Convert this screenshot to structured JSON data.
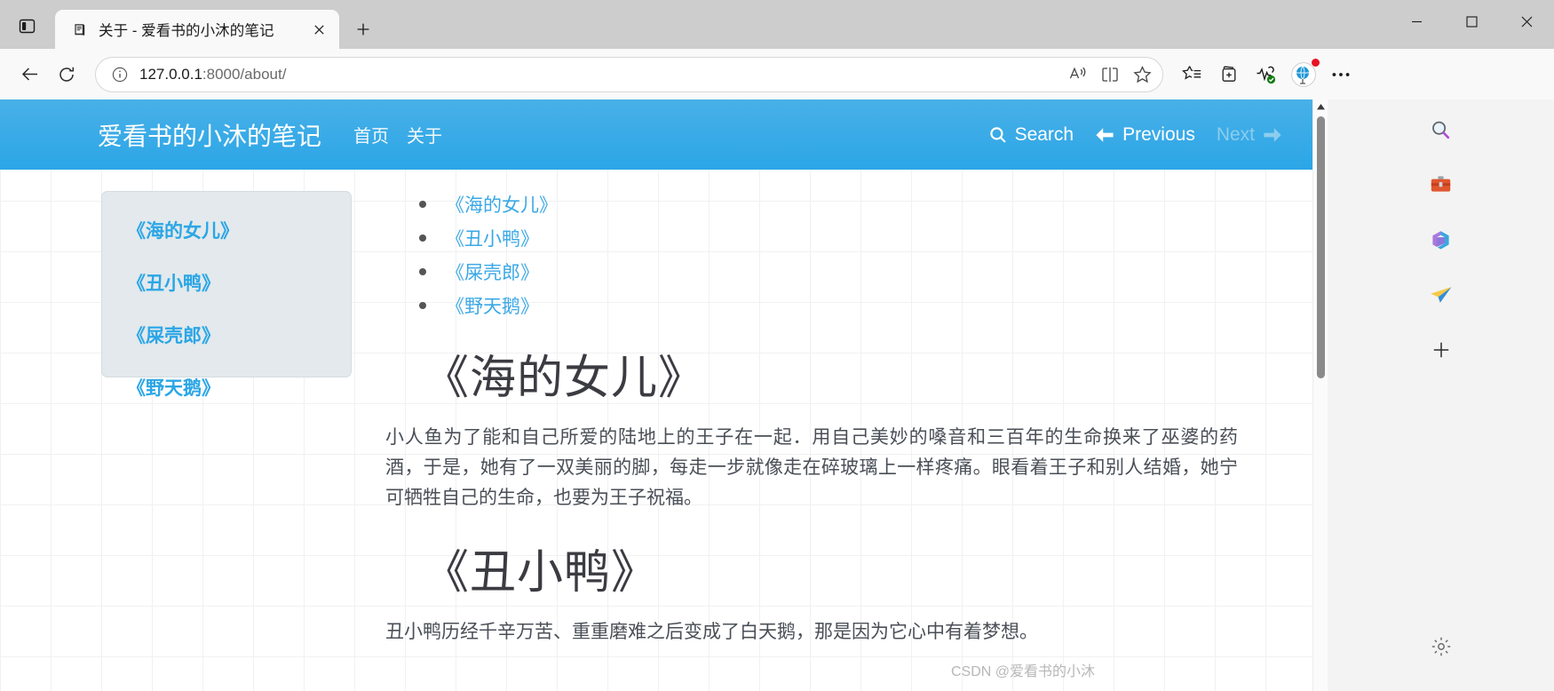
{
  "browser": {
    "tab": {
      "title": "关于 - 爱看书的小沐的笔记",
      "favicon_icon": "book-icon",
      "close_icon": "close-icon"
    },
    "tab_actions_icon": "tab-actions-icon",
    "new_tab_icon": "plus-icon",
    "window_controls": {
      "minimize_icon": "minimize-icon",
      "maximize_icon": "maximize-icon",
      "close_icon": "window-close-icon"
    },
    "nav": {
      "back_icon": "back-arrow-icon",
      "refresh_icon": "refresh-icon"
    },
    "omnibox": {
      "info_icon": "info-circle-icon",
      "url_host": "127.0.0.1",
      "url_path": ":8000/about/",
      "read_aloud_icon": "read-aloud-icon",
      "split_screen_icon": "split-screen-icon",
      "favorite_icon": "star-icon"
    },
    "toolbar": {
      "favorites_icon": "favorites-star-list-icon",
      "collections_icon": "collections-icon",
      "browser_essentials_icon": "browser-essentials-icon",
      "profile_icon": "globe-avatar-icon",
      "settings_more_icon": "more-ellipsis-icon"
    },
    "scrollbar": {
      "up_arrow_icon": "scroll-up-arrow-icon"
    }
  },
  "edge_sidebar": {
    "items": [
      {
        "icon": "search-icon",
        "name": "sidebar-search"
      },
      {
        "icon": "toolbox-icon",
        "name": "sidebar-tools"
      },
      {
        "icon": "microsoft365-icon",
        "name": "sidebar-microsoft365"
      },
      {
        "icon": "paper-plane-icon",
        "name": "sidebar-outlook"
      },
      {
        "icon": "plus-icon",
        "name": "sidebar-add-app"
      }
    ],
    "settings_icon": "gear-icon"
  },
  "site": {
    "brand": "爱看书的小沐的笔记",
    "nav": [
      {
        "label": "首页"
      },
      {
        "label": "关于"
      }
    ],
    "actions": {
      "search": {
        "label": "Search",
        "icon": "search-icon"
      },
      "previous": {
        "label": "Previous",
        "icon": "arrow-left-icon"
      },
      "next": {
        "label": "Next",
        "icon": "arrow-right-icon",
        "disabled": true
      }
    },
    "sidebar_links": [
      {
        "label": "《海的女儿》"
      },
      {
        "label": "《丑小鸭》"
      },
      {
        "label": "《屎壳郎》"
      },
      {
        "label": "《野天鹅》"
      }
    ],
    "toc": [
      {
        "label": "《海的女儿》"
      },
      {
        "label": "《丑小鸭》"
      },
      {
        "label": "《屎壳郎》"
      },
      {
        "label": "《野天鹅》"
      }
    ],
    "articles": [
      {
        "title": "《海的女儿》",
        "text": "小人鱼为了能和自己所爱的陆地上的王子在一起．用自己美妙的嗓音和三百年的生命换来了巫婆的药酒，于是，她有了一双美丽的脚，每走一步就像走在碎玻璃上一样疼痛。眼看着王子和别人结婚，她宁可牺牲自己的生命，也要为王子祝福。"
      },
      {
        "title": "《丑小鸭》",
        "text": "丑小鸭历经千辛万苦、重重磨难之后变成了白天鹅，那是因为它心中有着梦想。"
      }
    ]
  },
  "watermark": "CSDN @爱看书的小沐",
  "colors": {
    "site_accent": "#2ba6e6",
    "link_blue": "#3aa8e6",
    "card_bg": "#e3e9ec"
  }
}
